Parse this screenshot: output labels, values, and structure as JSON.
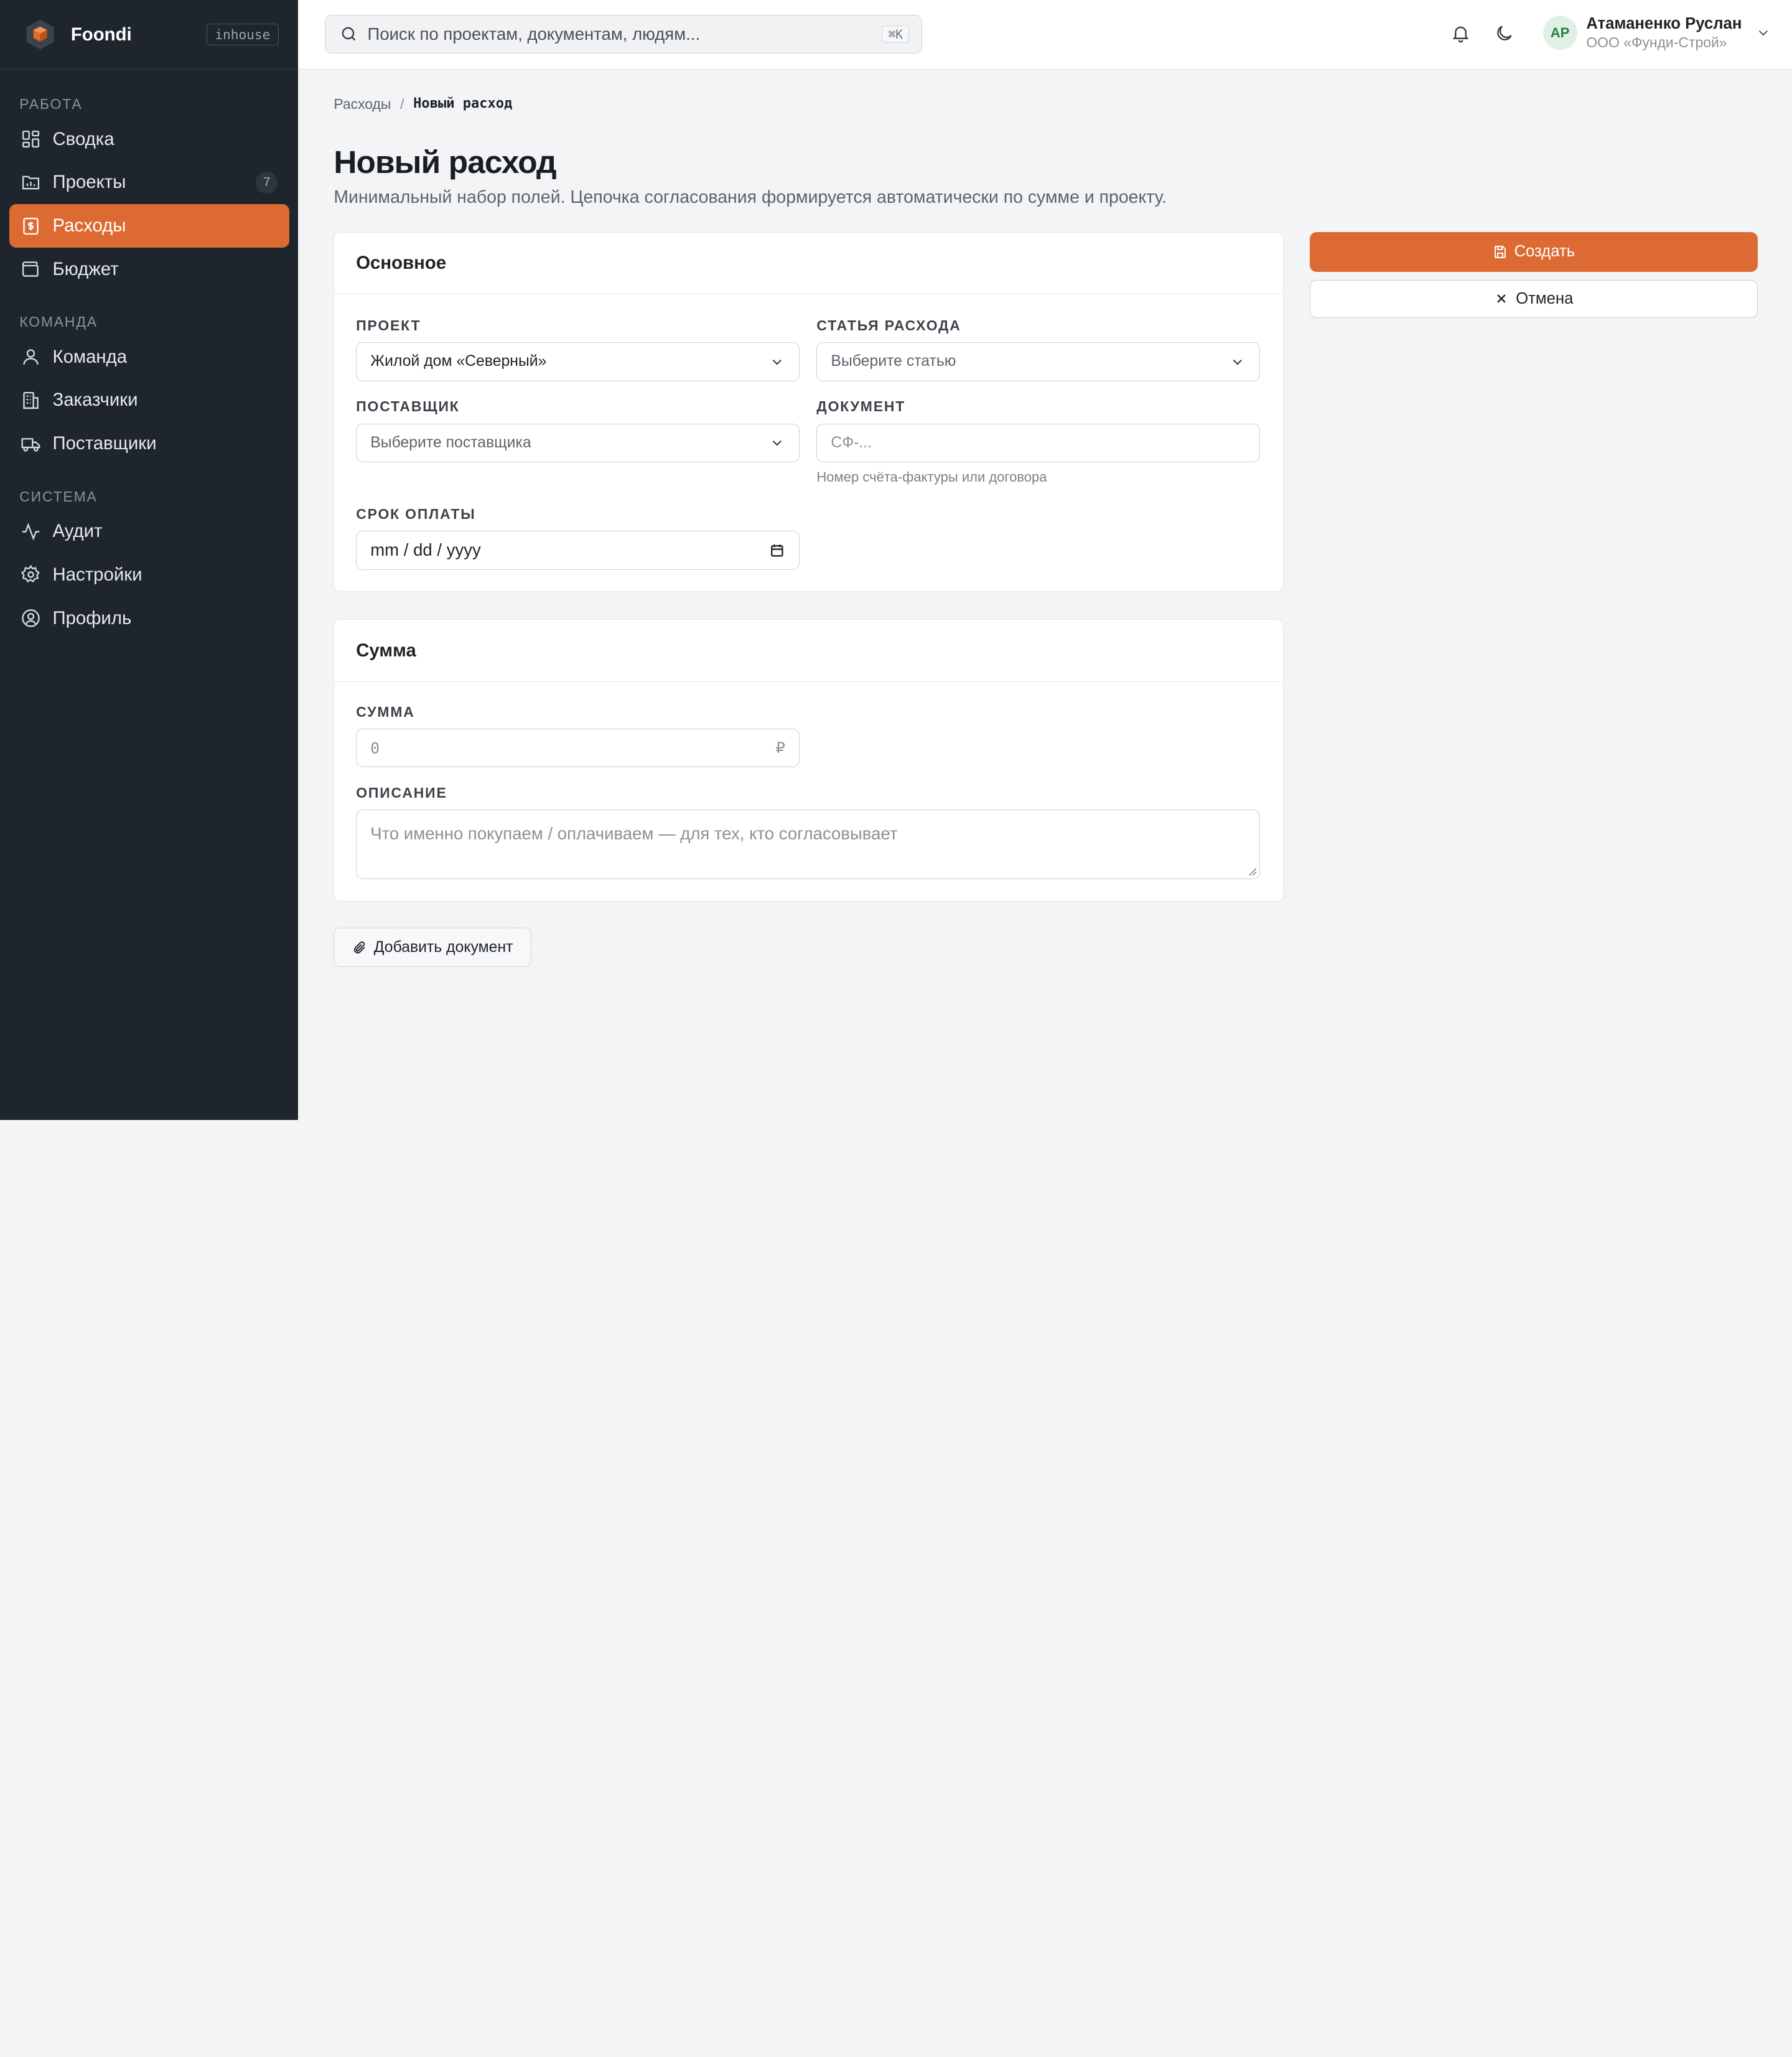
{
  "brand": {
    "name": "Foondi",
    "badge": "inhouse"
  },
  "sidebar": {
    "sections": [
      {
        "title": "РАБОТА"
      },
      {
        "title": "КОМАНДА"
      },
      {
        "title": "СИСТЕМА"
      }
    ],
    "items": [
      {
        "label": "Сводка",
        "icon": "grid-icon"
      },
      {
        "label": "Проекты",
        "icon": "chart-folder-icon",
        "count": "7"
      },
      {
        "label": "Расходы",
        "icon": "receipt-icon",
        "active": true
      },
      {
        "label": "Бюджет",
        "icon": "wallet-icon"
      },
      {
        "label": "Команда",
        "icon": "user-icon"
      },
      {
        "label": "Заказчики",
        "icon": "building-icon"
      },
      {
        "label": "Поставщики",
        "icon": "truck-icon"
      },
      {
        "label": "Аудит",
        "icon": "activity-icon"
      },
      {
        "label": "Настройки",
        "icon": "gear-icon"
      },
      {
        "label": "Профиль",
        "icon": "user-circle-icon"
      }
    ]
  },
  "topbar": {
    "search_placeholder": "Поиск по проектам, документам, людям...",
    "search_shortcut": "⌘K",
    "user": {
      "initials": "АР",
      "name": "Атаманенко Руслан",
      "org": "ООО «Фунди-Строй»"
    }
  },
  "breadcrumb": {
    "parent": "Расходы",
    "separator": "/",
    "current": "Новый расход"
  },
  "page": {
    "title": "Новый расход",
    "subtitle": "Минимальный набор полей. Цепочка согласования формируется автоматически по сумме и проекту."
  },
  "card_main": {
    "title": "Основное",
    "project": {
      "label": "ПРОЕКТ",
      "value": "Жилой дом «Северный»"
    },
    "expense_item": {
      "label": "СТАТЬЯ РАСХОДА",
      "placeholder": "Выберите статью"
    },
    "supplier": {
      "label": "ПОСТАВЩИК",
      "placeholder": "Выберите поставщика"
    },
    "document": {
      "label": "ДОКУМЕНТ",
      "placeholder": "СФ-...",
      "hint": "Номер счёта-фактуры или договора"
    },
    "due_date": {
      "label": "СРОК ОПЛАТЫ",
      "placeholder": "mm / dd / yyyy"
    }
  },
  "card_sum": {
    "title": "Сумма",
    "amount": {
      "label": "СУММА",
      "placeholder": "0",
      "currency": "₽"
    },
    "description": {
      "label": "ОПИСАНИЕ",
      "placeholder": "Что именно покупаем / оплачиваем — для тех, кто согласовывает"
    }
  },
  "actions": {
    "create": "Создать",
    "cancel": "Отмена",
    "add_document": "Добавить документ"
  },
  "colors": {
    "accent": "#dc6a32",
    "sidebar_bg": "#1e252d",
    "page_bg": "#f3f4f6"
  }
}
